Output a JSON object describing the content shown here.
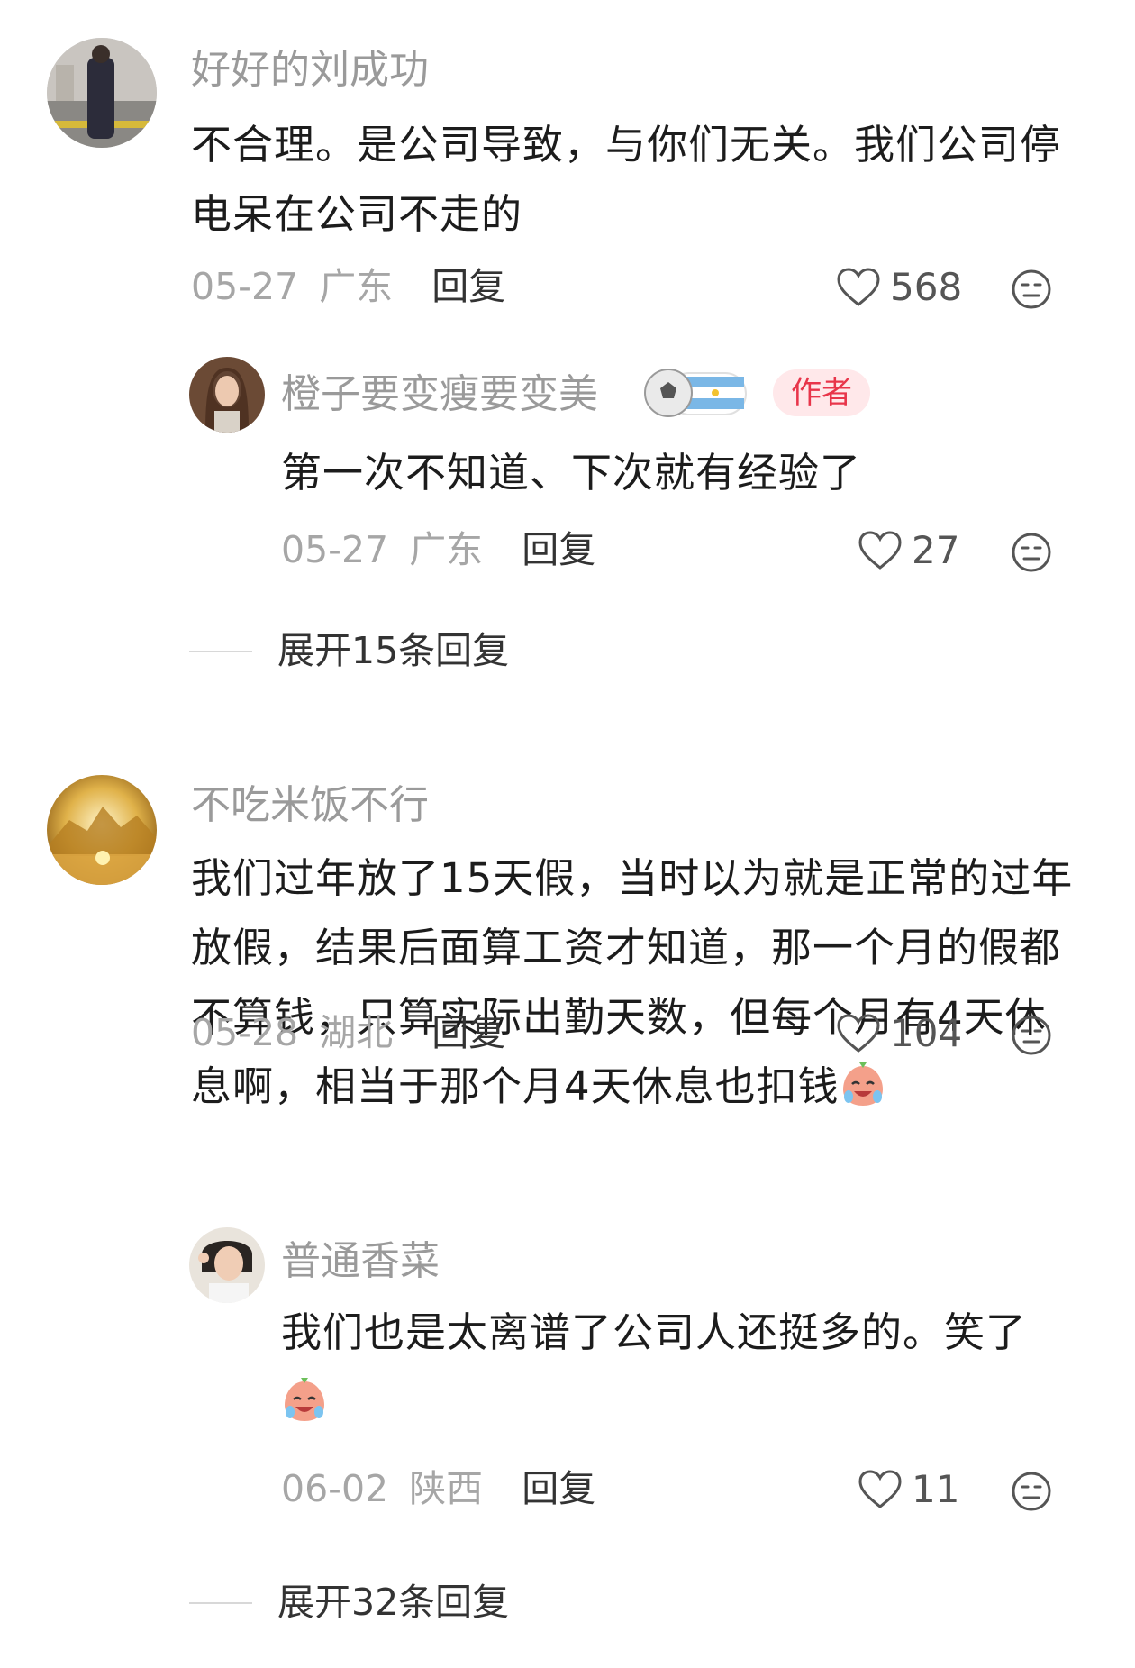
{
  "comments": [
    {
      "username": "好好的刘成功",
      "text": "不合理。是公司导致，与你们无关。我们公司停电呆在公司不走的",
      "date": "05-27",
      "location": "广东",
      "reply_label": "回复",
      "likes": "568",
      "avatar": "person-on-street-photo",
      "replies": [
        {
          "username": "橙子要变瘦要变美",
          "badge": "soccer-ball-argentina-flag-badge",
          "author_tag": "作者",
          "text": "第一次不知道、下次就有经验了",
          "date": "05-27",
          "location": "广东",
          "reply_label": "回复",
          "likes": "27",
          "avatar": "woman-portrait-photo"
        }
      ],
      "expand_label": "展开15条回复"
    },
    {
      "username": "不吃米饭不行",
      "text": "我们过年放了15天假，当时以为就是正常的过年放假，结果后面算工资才知道，那一个月的假都不算钱，只算实际出勤天数，但每个月有4天休息啊，相当于那个月4天休息也扣钱",
      "text_emoji": "crying-laughing-emoji",
      "date": "05-28",
      "location": "湖北",
      "reply_label": "回复",
      "likes": "104",
      "avatar": "golden-mountain-photo",
      "replies": [
        {
          "username": "普通香菜",
          "text": "我们也是太离谱了公司人还挺多的。笑了",
          "text_emoji": "crying-laughing-emoji",
          "date": "06-02",
          "location": "陕西",
          "reply_label": "回复",
          "likes": "11",
          "avatar": "girl-selfie-photo"
        }
      ],
      "expand_label": "展开32条回复"
    }
  ],
  "colors": {
    "username": "#9a9a9a",
    "meta": "#a6a6a6",
    "author_tag_bg": "#ffe8ea",
    "author_tag_text": "#e8354a"
  }
}
